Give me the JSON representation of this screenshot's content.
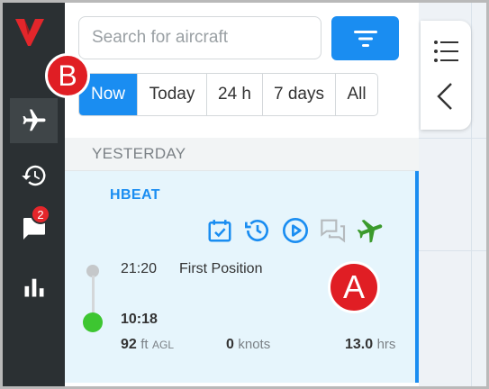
{
  "search": {
    "placeholder": "Search for aircraft"
  },
  "tabs": [
    {
      "label": "Now",
      "active": true
    },
    {
      "label": "Today",
      "active": false
    },
    {
      "label": "24 h",
      "active": false
    },
    {
      "label": "7 days",
      "active": false
    },
    {
      "label": "All",
      "active": false
    }
  ],
  "section": {
    "label": "YESTERDAY"
  },
  "card": {
    "callsign": "HBEAT",
    "first_time": "21:20",
    "first_label": "First Position",
    "last_time": "10:18",
    "altitude_value": "92",
    "altitude_unit": "ft",
    "altitude_ref": "AGL",
    "speed_value": "0",
    "speed_unit": "knots",
    "duration_value": "13.0",
    "duration_unit": "hrs"
  },
  "sidebar": {
    "messages_badge": "2"
  },
  "markers": {
    "a": "A",
    "b": "B"
  },
  "colors": {
    "accent": "#1a8df1",
    "sidebar": "#2b3033",
    "active_dot": "#3dc631",
    "marker": "#e01e24",
    "aircraft_icon": "#3b9a2c"
  }
}
